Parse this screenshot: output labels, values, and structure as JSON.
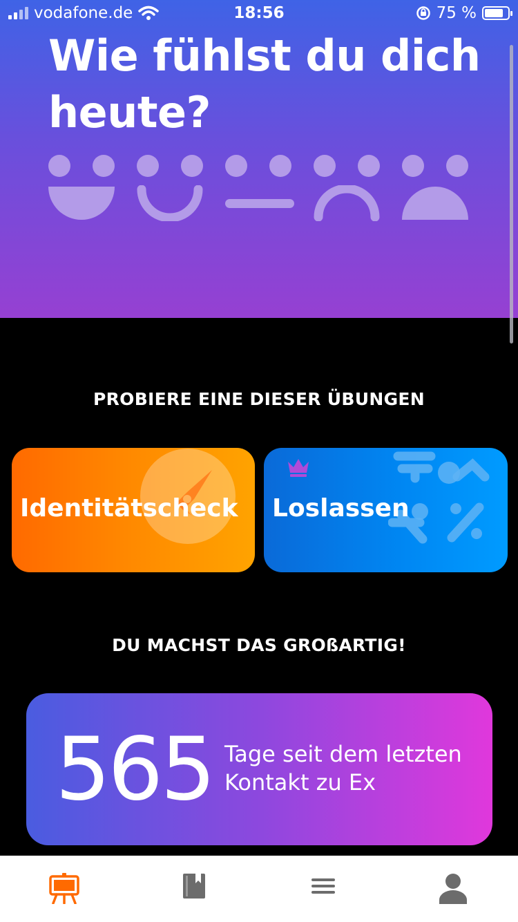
{
  "status_bar": {
    "carrier": "vodafone.de",
    "time": "18:56",
    "battery": "75 %"
  },
  "hero": {
    "title": "Wie fühlst du dich heute?",
    "mood_icons": [
      "very-happy-face-icon",
      "happy-face-icon",
      "neutral-face-icon",
      "sad-face-icon",
      "very-sad-face-icon"
    ]
  },
  "exercises": {
    "heading": "PROBIERE EINE DIESER ÜBUNGEN",
    "cards": [
      {
        "label": "Identitätscheck",
        "icon": "compass-icon",
        "color": "#ff8a00"
      },
      {
        "label": "Loslassen",
        "icon": "symbols-icon",
        "premium_icon": "crown-icon",
        "color": "#0086f2"
      }
    ]
  },
  "progress": {
    "heading": "DU MACHST DAS GROßARTIG!",
    "days": "565",
    "text": "Tage seit dem letzten Kontakt zu Ex"
  },
  "tab_bar": {
    "tabs": [
      {
        "icon": "easel-icon",
        "active": true,
        "color": "#ff6a00"
      },
      {
        "icon": "book-icon",
        "active": false
      },
      {
        "icon": "menu-icon",
        "active": false
      },
      {
        "icon": "profile-icon",
        "active": false
      }
    ]
  }
}
